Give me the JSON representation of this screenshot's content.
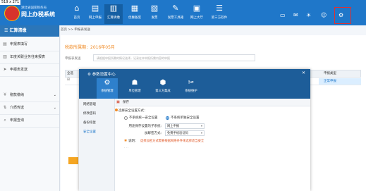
{
  "overlay": {
    "dimensions_label": "519 x 271"
  },
  "header": {
    "logo_sub": "湖北省国家税务局",
    "logo_title": "网上办税系统",
    "nav": [
      {
        "label": "首页",
        "icon": "home-icon",
        "glyph": "⌂"
      },
      {
        "label": "网上申报",
        "icon": "declare-icon",
        "glyph": "▤"
      },
      {
        "label": "汇算清缴",
        "icon": "settlement-icon",
        "glyph": "▥"
      },
      {
        "label": "优惠备案",
        "icon": "preference-icon",
        "glyph": "▦"
      },
      {
        "label": "发票",
        "icon": "invoice-icon",
        "glyph": "▧"
      },
      {
        "label": "发票工具箱",
        "icon": "toolbox-icon",
        "glyph": "✎"
      },
      {
        "label": "网上大厅",
        "icon": "hall-icon",
        "glyph": "▣"
      },
      {
        "label": "第三方软件",
        "icon": "thirdparty-icon",
        "glyph": "☰"
      }
    ],
    "icons": [
      "monitor-icon",
      "mail-icon",
      "bulb-icon",
      "user-icon",
      "settings-icon"
    ]
  },
  "sidebar": {
    "title": "汇算清缴",
    "items": [
      {
        "label": "申报表填写",
        "icon": "form-icon",
        "glyph": "▤"
      },
      {
        "label": "年度关联业务往来报表",
        "icon": "report-icon",
        "glyph": "▥"
      },
      {
        "label": "申报表发送",
        "icon": "send-icon",
        "glyph": "➤"
      },
      {
        "label": "税款缴纳",
        "icon": "payment-icon",
        "glyph": "¥"
      },
      {
        "label": "介质传送",
        "icon": "media-icon",
        "glyph": "⇅"
      },
      {
        "label": "申报查询",
        "icon": "query-icon",
        "glyph": "⌕"
      }
    ]
  },
  "breadcrumb": "首页 >> 申报表发送",
  "content": {
    "title": "税款所属期：2016年05月",
    "search_label": "申报表发送",
    "search_hint": "请根据申报所需的情况选择，记录在本申报所需内容的申报",
    "table_head_left": "全选",
    "table_head_right": "申报类型",
    "row_value": "正常申报"
  },
  "dialog": {
    "title": "参数设置中心",
    "tabs": [
      {
        "label": "系统管理",
        "icon": "system-icon",
        "glyph": "⚙"
      },
      {
        "label": "单位管理",
        "icon": "unit-icon",
        "glyph": "☗"
      },
      {
        "label": "第三方集成",
        "icon": "integration-icon",
        "glyph": "⬢"
      },
      {
        "label": "系统维护",
        "icon": "maintenance-icon",
        "glyph": "✂"
      }
    ],
    "left_menu": [
      "网络管理",
      "修改密码",
      "备份恢复",
      "安全设置"
    ],
    "panel_title": "保存",
    "security_label": "选择安全设置方式：",
    "radio_left": "不系统统一安全设置",
    "radio_right": "不系统单独安全设置",
    "field1_label": "用途保存设置的子系统：",
    "field1_value": "网上申报",
    "field2_label": "加解密方式：",
    "field2_value": "免费手机验证码",
    "note_label": "说明：",
    "note_text": "选择加密方式需要根据网络条件来选择适当安全",
    "status": "· · ·"
  }
}
